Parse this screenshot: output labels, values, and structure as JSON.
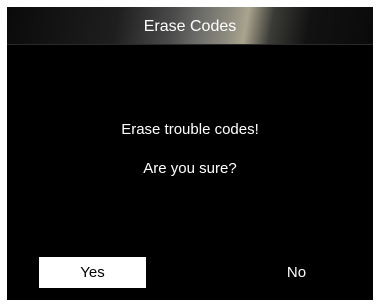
{
  "header": {
    "title": "Erase Codes"
  },
  "dialog": {
    "message_line_1": "Erase trouble codes!",
    "message_line_2": "Are you sure?"
  },
  "buttons": {
    "yes_label": "Yes",
    "no_label": "No",
    "selected": "Yes"
  },
  "colors": {
    "background": "#000000",
    "text": "#ffffff",
    "selected_button_bg": "#ffffff",
    "selected_button_text": "#000000"
  }
}
